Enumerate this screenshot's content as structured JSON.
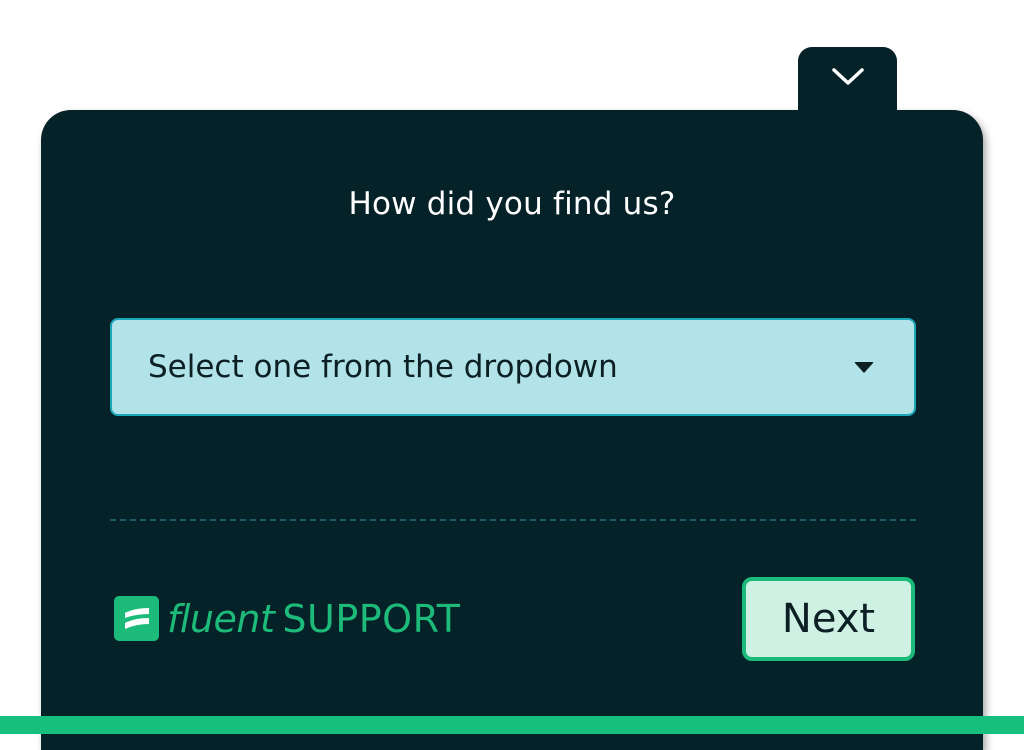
{
  "widget": {
    "collapse_icon": "chevron-down-icon",
    "question": "How did you find us?",
    "select": {
      "placeholder": "Select one from the dropdown",
      "caret_icon": "caret-down-icon"
    },
    "footer": {
      "logo_icon": "fluent-support-logo-icon",
      "brand_fluent": "fluent",
      "brand_support": "SUPPORT",
      "next_label": "Next"
    }
  },
  "colors": {
    "panel_bg": "#062229",
    "select_bg": "#b1e3e8",
    "select_border": "#1aa7b8",
    "brand_green": "#1dbb7a",
    "button_bg": "#cff1e4",
    "bottom_bar": "#17bf7d"
  }
}
